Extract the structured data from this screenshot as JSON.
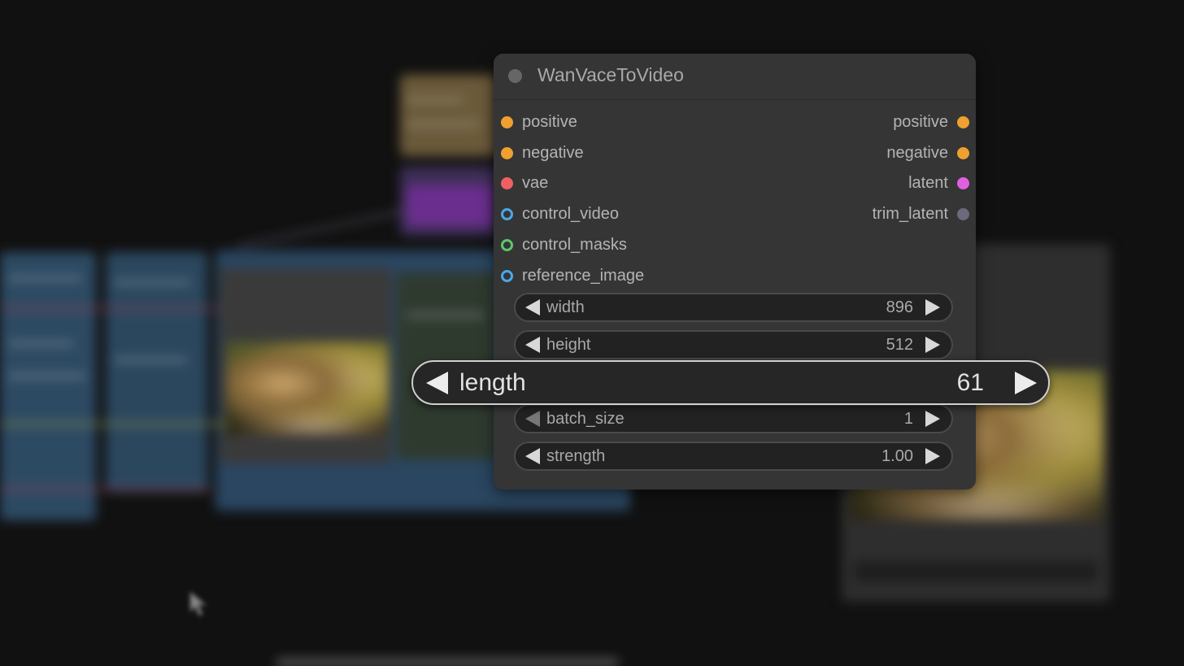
{
  "node": {
    "title": "WanVaceToVideo",
    "inputs": [
      {
        "label": "positive",
        "color": "#f0a030",
        "hollow": false
      },
      {
        "label": "negative",
        "color": "#f0a030",
        "hollow": false
      },
      {
        "label": "vae",
        "color": "#f06060",
        "hollow": false
      },
      {
        "label": "control_video",
        "color": "#4aa8e8",
        "hollow": true
      },
      {
        "label": "control_masks",
        "color": "#5cc86a",
        "hollow": true
      },
      {
        "label": "reference_image",
        "color": "#4aa8e8",
        "hollow": true
      }
    ],
    "outputs": [
      {
        "label": "positive",
        "color": "#f0a030"
      },
      {
        "label": "negative",
        "color": "#f0a030"
      },
      {
        "label": "latent",
        "color": "#e060e0"
      },
      {
        "label": "trim_latent",
        "color": "#6a6a7a"
      }
    ],
    "widgets": {
      "width": {
        "label": "width",
        "value": "896"
      },
      "height": {
        "label": "height",
        "value": "512"
      },
      "length": {
        "label": "length",
        "value": "61"
      },
      "batch_size": {
        "label": "batch_size",
        "value": "1"
      },
      "strength": {
        "label": "strength",
        "value": "1.00"
      }
    }
  }
}
